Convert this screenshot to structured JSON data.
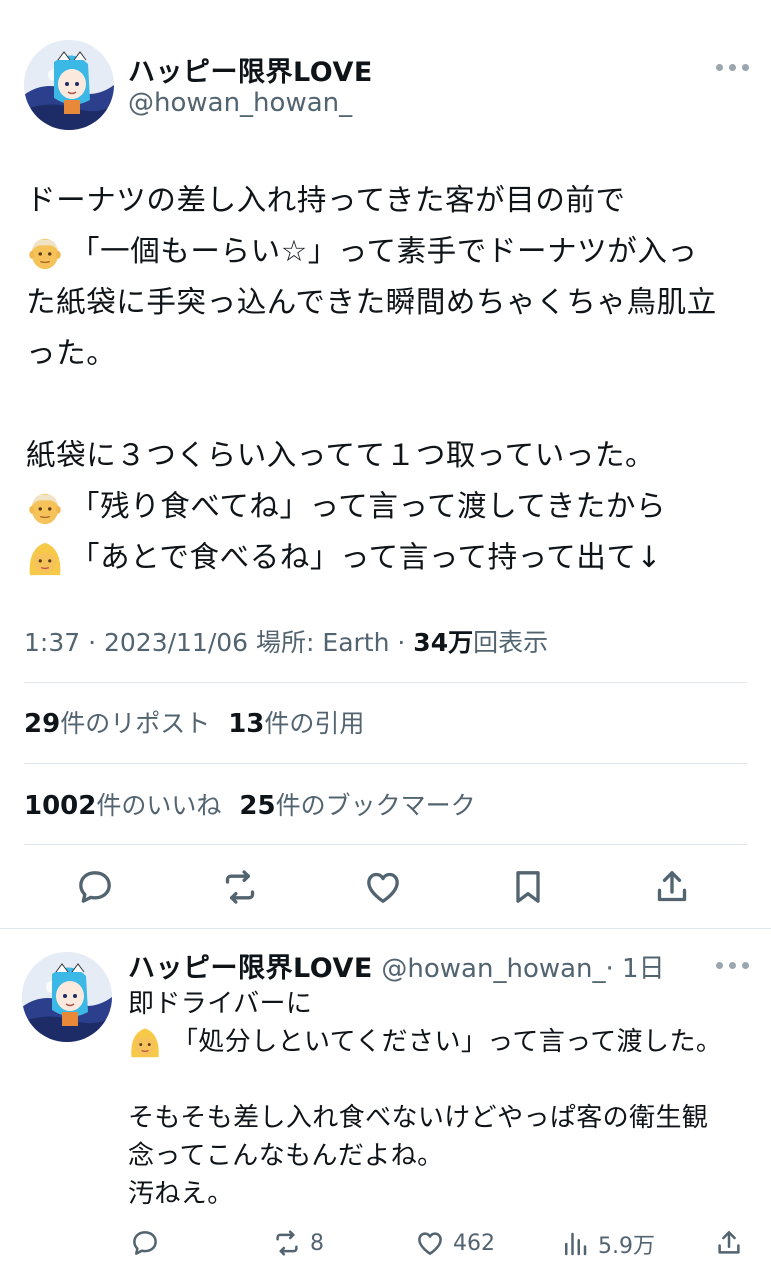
{
  "tweet": {
    "display_name": "ハッピー限界LOVE",
    "handle": "@howan_howan_",
    "lines": [
      "ドーナツの差し入れ持ってきた客が目の前で",
      "「一個もーらい☆」って素手でドーナツが入っ",
      "た紙袋に手突っ込んできた瞬間めちゃくちゃ鳥肌立",
      "った。",
      "",
      "紙袋に３つくらい入ってて１つ取っていった。",
      "「残り食べてね」って言って渡してきたから",
      "「あとで食べるね」って言って持って出て↓"
    ],
    "emojis": [
      "older-man-emoji",
      "older-man-emoji",
      "blond-woman-emoji"
    ],
    "meta": {
      "time": "1:37",
      "date": "2023/11/06",
      "location": "場所: Earth",
      "views_count": "34万",
      "views_label": "回表示",
      "separator": " · "
    },
    "stats": {
      "reposts_count": "29",
      "reposts_label": "件のリポスト",
      "quotes_count": "13",
      "quotes_label": "件の引用",
      "likes_count": "1002",
      "likes_label": "件のいいね",
      "bookmarks_count": "25",
      "bookmarks_label": "件のブックマーク"
    },
    "actions": [
      "reply-icon",
      "retweet-icon",
      "like-icon",
      "bookmark-icon",
      "share-icon"
    ]
  },
  "reply": {
    "display_name": "ハッピー限界LOVE",
    "handle": "@howan_howan_",
    "time_ago": "· 1日",
    "lines": [
      "即ドライバーに",
      "「処分しといてください」って言って渡した。",
      "",
      "そもそも差し入れ食べないけどやっぱ客の衛生観",
      "念ってこんなもんだよね。",
      "汚ねえ。"
    ],
    "emoji": "blond-woman-emoji",
    "actions": {
      "reply_count": "",
      "retweet_count": "8",
      "like_count": "462",
      "views_count": "5.9万"
    }
  },
  "colors": {
    "text": "#0f1419",
    "secondary": "#536471",
    "divider": "#e1e6ea"
  }
}
